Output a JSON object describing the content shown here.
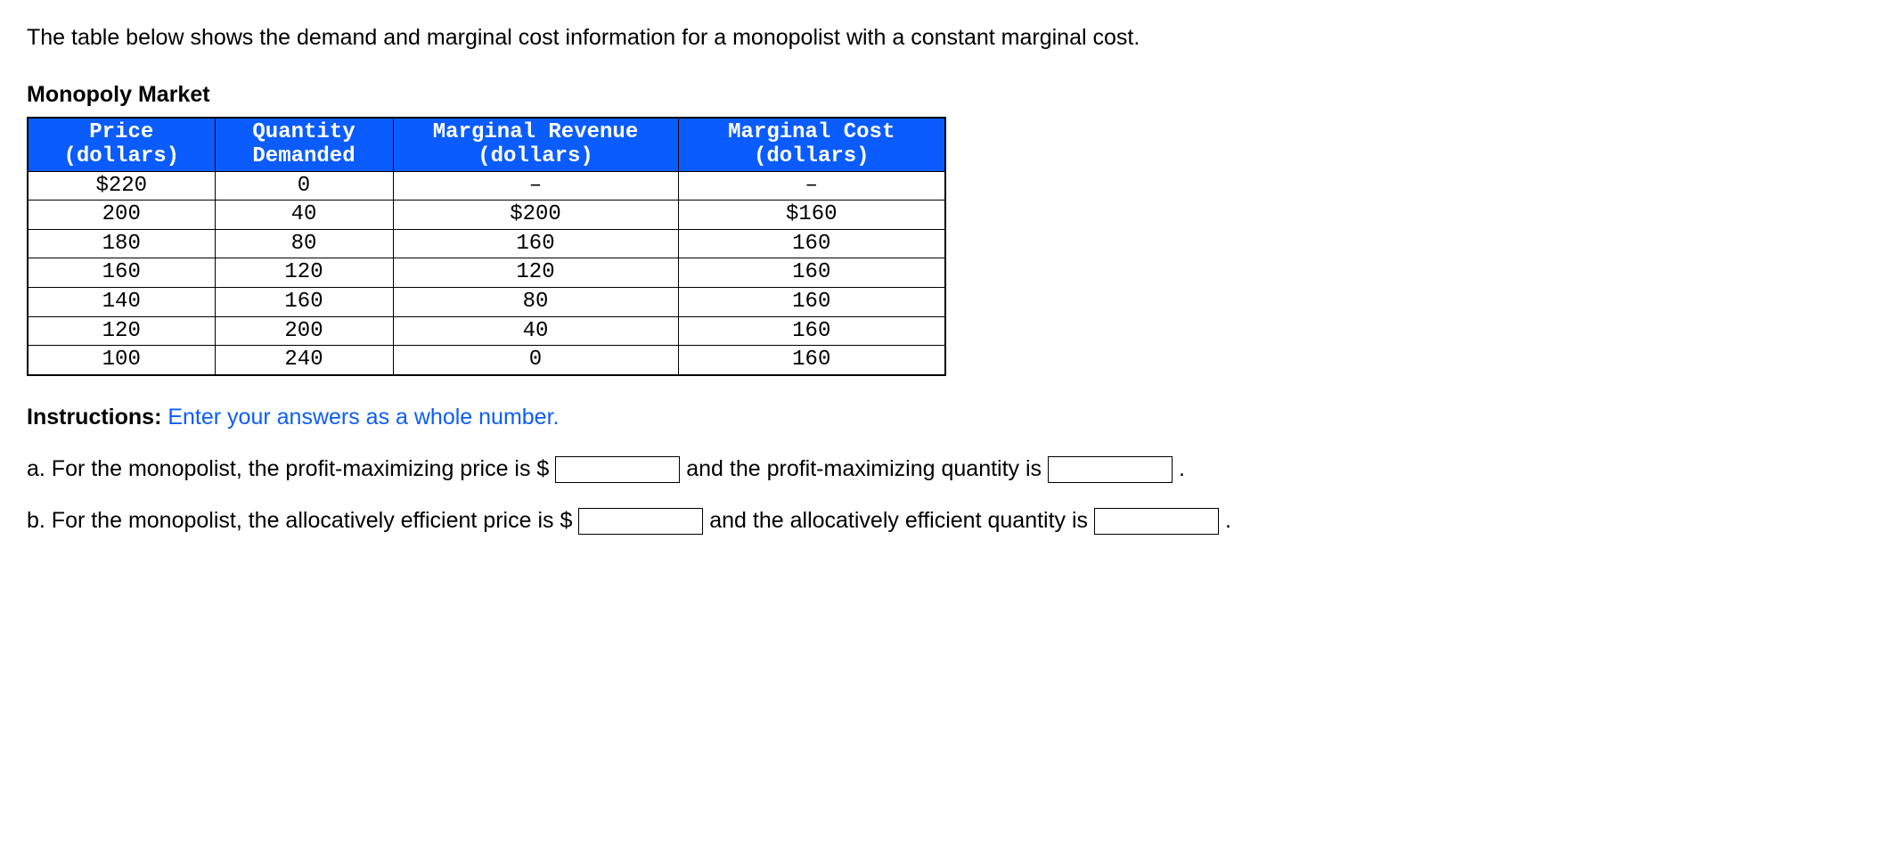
{
  "intro": "The table below shows the demand and marginal cost information for a monopolist with a constant marginal cost.",
  "tableTitle": "Monopoly Market",
  "headers": {
    "c0l1": "Price",
    "c0l2": "(dollars)",
    "c1l1": "Quantity",
    "c1l2": "Demanded",
    "c2l1": "Marginal Revenue",
    "c2l2": "(dollars)",
    "c3l1": "Marginal Cost",
    "c3l2": "(dollars)"
  },
  "rows": [
    {
      "price": "$220",
      "qty": "0",
      "mr": "–",
      "mc": "–"
    },
    {
      "price": "200",
      "qty": "40",
      "mr": "$200",
      "mc": "$160"
    },
    {
      "price": "180",
      "qty": "80",
      "mr": "160",
      "mc": "160"
    },
    {
      "price": "160",
      "qty": "120",
      "mr": "120",
      "mc": "160"
    },
    {
      "price": "140",
      "qty": "160",
      "mr": "80",
      "mc": "160"
    },
    {
      "price": "120",
      "qty": "200",
      "mr": "40",
      "mc": "160"
    },
    {
      "price": "100",
      "qty": "240",
      "mr": "0",
      "mc": "160"
    }
  ],
  "instructions": {
    "label": "Instructions:",
    "text": " Enter your answers as a whole number."
  },
  "qa": {
    "aPre": "a. For the monopolist, the profit-maximizing price is $ ",
    "aMid": " and the profit-maximizing quantity is ",
    "aEnd": ".",
    "bPre": "b. For the monopolist, the allocatively efficient price is $ ",
    "bMid": " and the allocatively efficient quantity is ",
    "bEnd": "."
  },
  "inputs": {
    "aPrice": "",
    "aQty": "",
    "bPrice": "",
    "bQty": ""
  }
}
